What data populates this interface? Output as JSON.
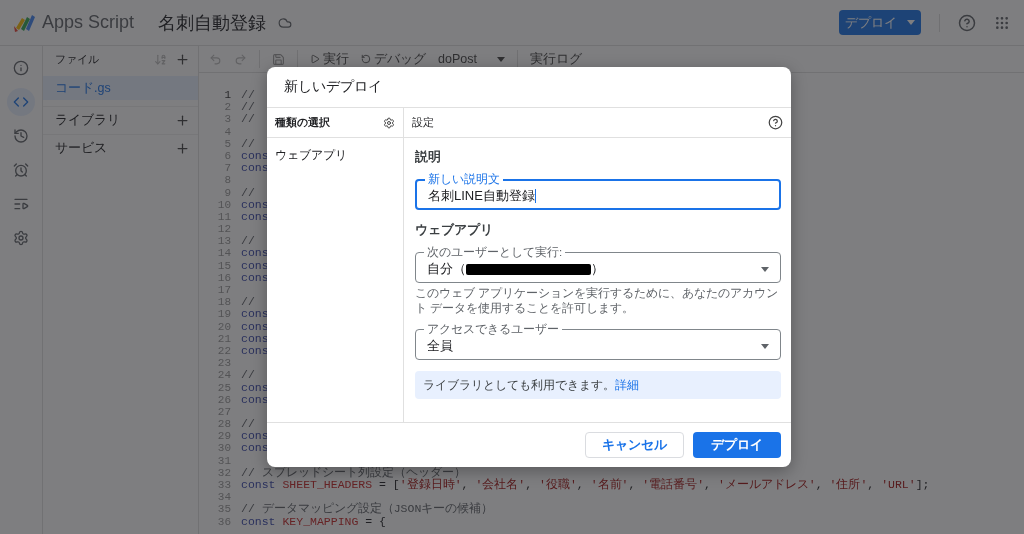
{
  "header": {
    "product": "Apps Script",
    "project": "名刺自動登録",
    "deploy_button": "デプロイ"
  },
  "rail": [
    {
      "kind": "info",
      "selected": false
    },
    {
      "kind": "code",
      "selected": true
    },
    {
      "kind": "history",
      "selected": false
    },
    {
      "kind": "alarm",
      "selected": false
    },
    {
      "kind": "executions",
      "selected": false
    },
    {
      "kind": "settings",
      "selected": false
    }
  ],
  "files_panel": {
    "title": "ファイル",
    "files": [
      {
        "name": "コード.gs",
        "selected": true
      }
    ],
    "sections": [
      "ライブラリ",
      "サービス"
    ]
  },
  "toolbar": {
    "run": "実行",
    "debug": "デバッグ",
    "function": "doPost",
    "log": "実行ログ"
  },
  "editor": {
    "lines": [
      {
        "number": "1",
        "tokens": [
          {
            "kind": "comment",
            "text": "//"
          }
        ]
      },
      {
        "number": "2",
        "tokens": [
          {
            "kind": "comment",
            "text": "//"
          }
        ]
      },
      {
        "number": "3",
        "tokens": [
          {
            "kind": "comment",
            "text": "//"
          }
        ]
      },
      {
        "number": "4"
      },
      {
        "number": "5",
        "tokens": [
          {
            "kind": "comment",
            "text": "//"
          }
        ]
      },
      {
        "number": "6",
        "tokens": [
          {
            "kind": "keyword",
            "text": "cons"
          }
        ]
      },
      {
        "number": "7",
        "tokens": [
          {
            "kind": "keyword",
            "text": "cons"
          }
        ]
      },
      {
        "number": "8"
      },
      {
        "number": "9",
        "tokens": [
          {
            "kind": "comment",
            "text": "//"
          }
        ]
      },
      {
        "number": "10",
        "tokens": [
          {
            "kind": "keyword",
            "text": "cons"
          }
        ]
      },
      {
        "number": "11",
        "tokens": [
          {
            "kind": "keyword",
            "text": "cons"
          }
        ]
      },
      {
        "number": "12"
      },
      {
        "number": "13",
        "tokens": [
          {
            "kind": "comment",
            "text": "//"
          }
        ]
      },
      {
        "number": "14",
        "tokens": [
          {
            "kind": "keyword",
            "text": "cons"
          }
        ]
      },
      {
        "number": "15",
        "tokens": [
          {
            "kind": "keyword",
            "text": "cons"
          }
        ]
      },
      {
        "number": "16",
        "tokens": [
          {
            "kind": "keyword",
            "text": "cons"
          }
        ]
      },
      {
        "number": "17"
      },
      {
        "number": "18",
        "tokens": [
          {
            "kind": "comment",
            "text": "//"
          }
        ]
      },
      {
        "number": "19",
        "tokens": [
          {
            "kind": "keyword",
            "text": "cons"
          }
        ]
      },
      {
        "number": "20",
        "tokens": [
          {
            "kind": "keyword",
            "text": "cons"
          }
        ]
      },
      {
        "number": "21",
        "tokens": [
          {
            "kind": "keyword",
            "text": "cons"
          }
        ]
      },
      {
        "number": "22",
        "tokens": [
          {
            "kind": "keyword",
            "text": "cons"
          }
        ]
      },
      {
        "number": "23"
      },
      {
        "number": "24",
        "tokens": [
          {
            "kind": "comment",
            "text": "//"
          }
        ]
      },
      {
        "number": "25",
        "tokens": [
          {
            "kind": "keyword",
            "text": "cons"
          }
        ]
      },
      {
        "number": "26",
        "tokens": [
          {
            "kind": "keyword",
            "text": "cons"
          }
        ]
      },
      {
        "number": "27"
      },
      {
        "number": "28",
        "tokens": [
          {
            "kind": "comment",
            "text": "//"
          }
        ]
      },
      {
        "number": "29",
        "tokens": [
          {
            "kind": "keyword",
            "text": "cons"
          }
        ]
      },
      {
        "number": "30",
        "tokens": [
          {
            "kind": "keyword",
            "text": "cons"
          }
        ]
      },
      {
        "number": "31"
      },
      {
        "number": "32",
        "tokens": [
          {
            "kind": "comment",
            "text": "// スプレッドシート列設定（ヘッダー）"
          }
        ]
      },
      {
        "number": "33",
        "tokens": [
          {
            "kind": "keyword",
            "text": "const "
          },
          {
            "kind": "name",
            "text": "SHEET_HEADERS"
          },
          {
            "kind": "plain",
            "text": " = ["
          },
          {
            "kind": "string",
            "text": "'登録日時'"
          },
          {
            "kind": "plain",
            "text": ", "
          },
          {
            "kind": "string",
            "text": "'会社名'"
          },
          {
            "kind": "plain",
            "text": ", "
          },
          {
            "kind": "string",
            "text": "'役職'"
          },
          {
            "kind": "plain",
            "text": ", "
          },
          {
            "kind": "string",
            "text": "'名前'"
          },
          {
            "kind": "plain",
            "text": ", "
          },
          {
            "kind": "string",
            "text": "'電話番号'"
          },
          {
            "kind": "plain",
            "text": ", "
          },
          {
            "kind": "string",
            "text": "'メールアドレス'"
          },
          {
            "kind": "plain",
            "text": ", "
          },
          {
            "kind": "string",
            "text": "'住所'"
          },
          {
            "kind": "plain",
            "text": ", "
          },
          {
            "kind": "string",
            "text": "'URL'"
          },
          {
            "kind": "plain",
            "text": "];"
          }
        ]
      },
      {
        "number": "34"
      },
      {
        "number": "35",
        "tokens": [
          {
            "kind": "comment",
            "text": "// データマッピング設定（JSONキーの候補）"
          }
        ]
      },
      {
        "number": "36",
        "tokens": [
          {
            "kind": "keyword",
            "text": "const "
          },
          {
            "kind": "name",
            "text": "KEY_MAPPING"
          },
          {
            "kind": "plain",
            "text": " = {"
          }
        ]
      }
    ]
  },
  "dialog": {
    "title": "新しいデプロイ",
    "type_header": "種類の選択",
    "types": [
      {
        "name": "ウェブアプリ",
        "selected": true
      }
    ],
    "settings_header": "設定",
    "description_heading": "説明",
    "description_field": {
      "label": "新しい説明文",
      "value": "名刺LINE自動登録",
      "focused": true
    },
    "webapp_heading": "ウェブアプリ",
    "run_as": {
      "label": "次のユーザーとして実行:",
      "value_prefix": "自分（",
      "value_suffix": "）",
      "redacted": true
    },
    "run_as_help": "このウェブ アプリケーションを実行するために、あなたのアカウント データを使用することを許可します。",
    "access": {
      "label": "アクセスできるユーザー",
      "value_prefix": "全員",
      "redacted": false
    },
    "info": {
      "text": "ライブラリとしても利用できます。",
      "link": "詳細"
    },
    "cancel_button": "キャンセル",
    "deploy_button": "デプロイ"
  }
}
